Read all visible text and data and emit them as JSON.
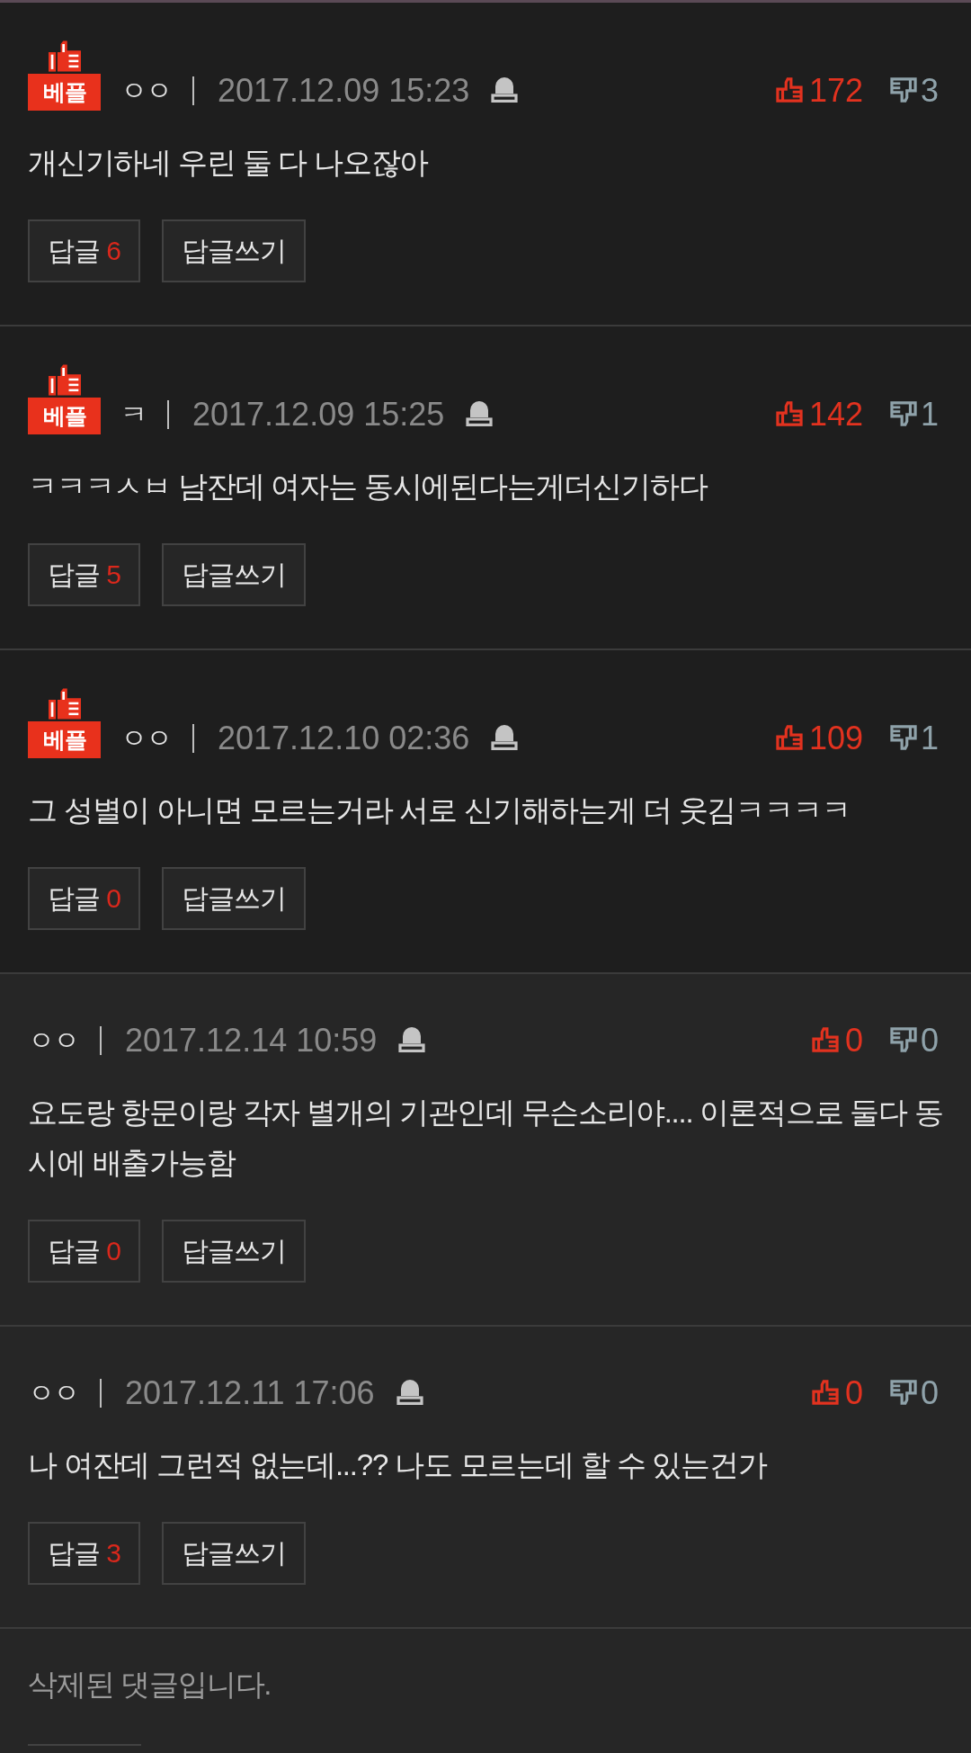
{
  "comments": [
    {
      "kind": "comment",
      "best": true,
      "badge": "베플",
      "nickname": "ㅇㅇ",
      "date": "2017.12.09 15:23",
      "likes": "172",
      "dislikes": "3",
      "text": "개신기하네 우린 둘 다 나오잖아",
      "reply_label": "답글",
      "reply_count": "6",
      "write_label": "답글쓰기"
    },
    {
      "kind": "comment",
      "best": true,
      "badge": "베플",
      "nickname": "ㅋ",
      "date": "2017.12.09 15:25",
      "likes": "142",
      "dislikes": "1",
      "text": "ㅋㅋㅋㅅㅂ 남잔데 여자는 동시에된다는게더신기하다",
      "reply_label": "답글",
      "reply_count": "5",
      "write_label": "답글쓰기"
    },
    {
      "kind": "comment",
      "best": true,
      "badge": "베플",
      "nickname": "ㅇㅇ",
      "date": "2017.12.10 02:36",
      "likes": "109",
      "dislikes": "1",
      "text": "그 성별이 아니면 모르는거라 서로 신기해하는게 더 웃김ㅋㅋㅋㅋ",
      "reply_label": "답글",
      "reply_count": "0",
      "write_label": "답글쓰기"
    },
    {
      "kind": "comment",
      "best": false,
      "nickname": "ㅇㅇ",
      "date": "2017.12.14 10:59",
      "likes": "0",
      "dislikes": "0",
      "text": "요도랑 항문이랑 각자 별개의 기관인데 무슨소리야.... 이론적으로 둘다 동시에 배출가능함",
      "reply_label": "답글",
      "reply_count": "0",
      "write_label": "답글쓰기"
    },
    {
      "kind": "comment",
      "best": false,
      "nickname": "ㅇㅇ",
      "date": "2017.12.11 17:06",
      "likes": "0",
      "dislikes": "0",
      "text": "나 여잔데 그런적 없는데...?? 나도 모르는데 할 수 있는건가",
      "reply_label": "답글",
      "reply_count": "3",
      "write_label": "답글쓰기"
    },
    {
      "kind": "deleted",
      "best": false,
      "text": "삭제된 댓글입니다."
    }
  ]
}
